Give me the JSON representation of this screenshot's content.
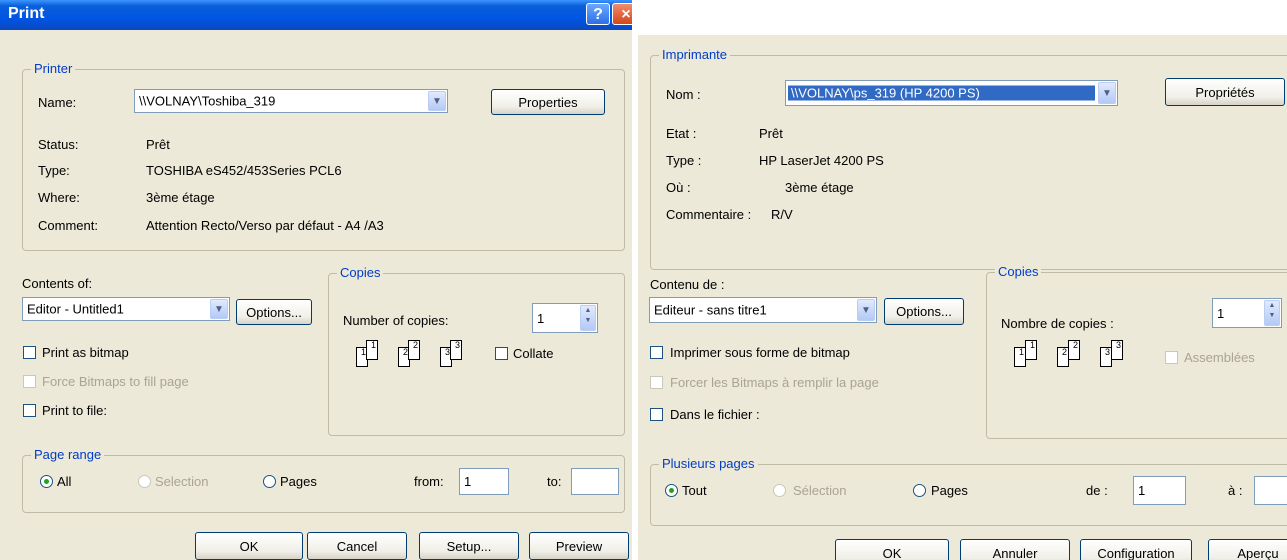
{
  "left": {
    "title": "Print",
    "help_label": "?",
    "close_label": "×",
    "printer": {
      "legend": "Printer",
      "name_label": "Name:",
      "name_value": "\\\\VOLNAY\\Toshiba_319",
      "properties_label": "Properties",
      "status_label": "Status:",
      "status_value": "Prêt",
      "type_label": "Type:",
      "type_value": "TOSHIBA eS452/453Series PCL6",
      "where_label": "Where:",
      "where_value": "3ème étage",
      "comment_label": "Comment:",
      "comment_value": "Attention Recto/Verso par défaut - A4 /A3"
    },
    "contents_label": "Contents of:",
    "contents_value": "Editor - Untitled1",
    "options_label": "Options...",
    "print_bitmap": "Print as bitmap",
    "force_bitmaps": "Force Bitmaps to fill page",
    "print_file": "Print to file:",
    "copies": {
      "legend": "Copies",
      "number_label": "Number of copies:",
      "number_value": "1",
      "collate_label": "Collate",
      "pages": [
        "1",
        "1",
        "2",
        "2",
        "3",
        "3"
      ]
    },
    "page_range": {
      "legend": "Page range",
      "all": "All",
      "selection": "Selection",
      "pages": "Pages",
      "from_label": "from:",
      "from_value": "1",
      "to_label": "to:",
      "to_value": ""
    },
    "buttons": {
      "ok": "OK",
      "cancel": "Cancel",
      "setup": "Setup...",
      "preview": "Preview"
    }
  },
  "right": {
    "printer": {
      "legend": "Imprimante",
      "name_label": "Nom :",
      "name_value": "\\\\VOLNAY\\ps_319 (HP 4200 PS)",
      "properties_label": "Propriétés",
      "status_label": "Etat :",
      "status_value": "Prêt",
      "type_label": "Type :",
      "type_value": "HP LaserJet 4200 PS",
      "where_label": "Où :",
      "where_value": "3ème étage",
      "comment_label": "Commentaire :",
      "comment_value": "R/V"
    },
    "contents_label": "Contenu de :",
    "contents_value": "Editeur - sans titre1",
    "options_label": "Options...",
    "print_bitmap": "Imprimer sous forme de bitmap",
    "force_bitmaps": "Forcer les Bitmaps à remplir la page",
    "print_file": "Dans le fichier :",
    "copies": {
      "legend": "Copies",
      "number_label": "Nombre de copies :",
      "number_value": "1",
      "collate_label": "Assemblées",
      "pages": [
        "1",
        "1",
        "2",
        "2",
        "3",
        "3"
      ]
    },
    "page_range": {
      "legend": "Plusieurs pages",
      "all": "Tout",
      "selection": "Sélection",
      "pages": "Pages",
      "from_label": "de :",
      "from_value": "1",
      "to_label": "à :",
      "to_value": ""
    },
    "buttons": {
      "ok": "OK",
      "cancel": "Annuler",
      "setup": "Configuration",
      "preview": "Aperçu"
    }
  }
}
